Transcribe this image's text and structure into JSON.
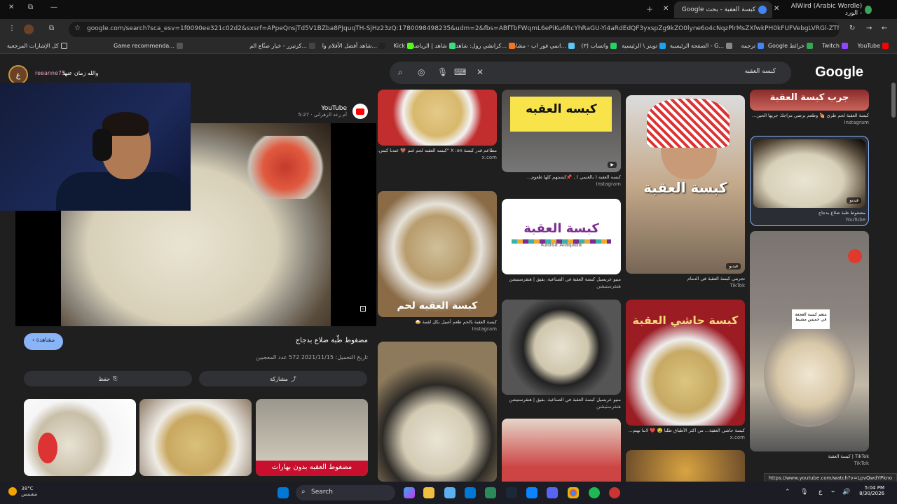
{
  "tabs": [
    {
      "title": "كبسة العقبة - بحث Google",
      "active": true
    },
    {
      "title": "AlWird (Arabic Wordle) - الورد",
      "active": false
    }
  ],
  "address": {
    "url": "google.com/search?sca_esv=1f0090ee321c02d2&sxsrf=APpeQnsjTd5V1BZba8PJquqTH-SjHz23zQ:1780098498235&udm=2&fbs=ABfTbFWqmL6ePiKu6ftcYhRaGU-Yi4aRdEdQF3yxspZg9kZO0lyne6o4cNqzPlrMsZXfwkPH0kFUFVebgLVRGl-ZTf0..."
  },
  "bookmarks": [
    "YouTube",
    "Twitch",
    "Google خرائط",
    "ترجمة",
    "الصفحة الرئيسية - G...",
    "تويتر \\ الرئيسية",
    "(٣) واتساب",
    "انمي فور اب - مشاهد...",
    "كرانشي رول: شاهد أ...",
    "شاهد | الرياضة",
    "Kick",
    "شاهد أفضل الأفلام وا...",
    "كرتيزر - خيار صنّاع الم...",
    "Game recommenda...",
    "كل الإشارات المرجعية"
  ],
  "google": {
    "logo": "Google",
    "query": "كبسه العقبه"
  },
  "streamer": {
    "initial": "ع",
    "handle": "reeanne75",
    "message": "والله زمان عنها"
  },
  "preview": {
    "channel": "YouTube",
    "channel_sub": "أم رعد الزهراني · 5:27",
    "back_label": "مشاهدة",
    "title": "مضغوط طّبة ضلاع بدجاج",
    "meta": "تاريخ التحميل: 2021/11/15   572 عدد المعجبين",
    "save_label": "حفظ",
    "share_label": "مشاركة",
    "thumb3_text": "مضغوط العقبه بدون بهارات"
  },
  "cards": [
    {
      "cap": "مطاعم قدر كبسة X :on \"كبسه العقبه لحم غنم 🤎 عندنا كبس...\"",
      "src": "x.com",
      "text": ""
    },
    {
      "cap": "كبسه العقبه ( بالغنمي ) , 📌كبستهم كلها طعوم...",
      "src": "Instagram",
      "text": "كبسه العقبه"
    },
    {
      "cap": "كبسة العقبة بالحم طعم أصيل بكل لقمة 🍛",
      "src": "Instagram",
      "text": "كبسة العقبه لحم"
    },
    {
      "cap": "منيو عربسيل كبسة العقبة في الصناعية، بقيق | هنقرستيشن",
      "src": "هنقرستيشن",
      "text": "كبسة العقبة",
      "sub": "Kabsa Alaqaba"
    },
    {
      "cap": "منيو عربسيل كبسة العقبة في الصناعية، بقيق | هنقرستيشن",
      "src": "هنقرستيشن",
      "text": ""
    },
    {
      "cap": "",
      "src": "",
      "text": ""
    },
    {
      "cap": "",
      "src": "",
      "text": ""
    },
    {
      "cap": "تجربتي كبسة العقبة في الدمام",
      "src": "TikTok",
      "text": "كبسة العقبة",
      "badge": "فيديو"
    },
    {
      "cap": "كبسة حاشي العقبة... من اكثر الأطباق طلبا 🤤 ❤️ لاننا نهتم...",
      "src": "x.com",
      "text": "كبسة حاشي العقبة"
    },
    {
      "cap": "",
      "src": "",
      "text": ""
    },
    {
      "cap": "كبسة العقبة لحم طري 🍖 وطعم يرضي مزاجك جربها الحين...",
      "src": "Instagram",
      "text": "جرب كبسة العقبة"
    },
    {
      "cap": "مضغوط طبة ضلاع بدجاج",
      "src": "YouTube",
      "text": "",
      "badge": "فيديو"
    },
    {
      "cap": "TikTok | كبسة العقبة",
      "src": "TikTok",
      "text": "متعم كبسة العجعة في خميس مشيط"
    }
  ],
  "status_url": "https://www.youtube.com/watch?v=LpvQwdYPkno",
  "taskbar": {
    "temp": "38°C",
    "weather": "مشمس",
    "search": "Search",
    "time": "5:04 PM",
    "date": "8/30/2026"
  }
}
